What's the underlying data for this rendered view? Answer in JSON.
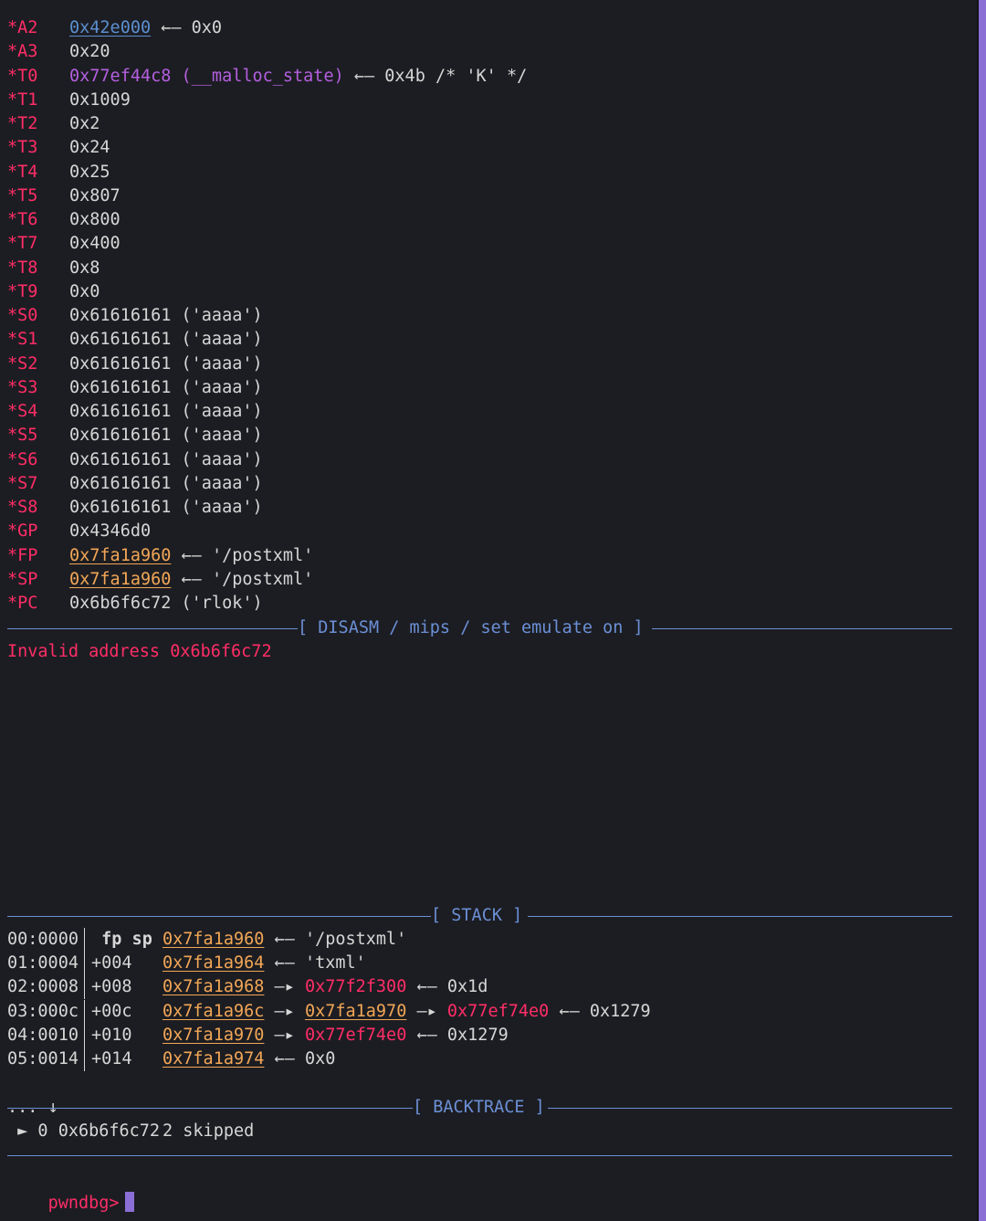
{
  "registers": [
    {
      "name": "*A2",
      "value": "0x42e000",
      "value_style": "blue",
      "suffix": " ←— 0x0"
    },
    {
      "name": "*A3",
      "value": "0x20",
      "value_style": "white",
      "suffix": ""
    },
    {
      "name": "*T0",
      "value": "0x77ef44c8 (__malloc_state)",
      "value_style": "purple",
      "suffix": " ←— 0x4b /* 'K' */"
    },
    {
      "name": "*T1",
      "value": "0x1009",
      "value_style": "white",
      "suffix": ""
    },
    {
      "name": "*T2",
      "value": "0x2",
      "value_style": "white",
      "suffix": ""
    },
    {
      "name": "*T3",
      "value": "0x24",
      "value_style": "white",
      "suffix": ""
    },
    {
      "name": "*T4",
      "value": "0x25",
      "value_style": "white",
      "suffix": ""
    },
    {
      "name": "*T5",
      "value": "0x807",
      "value_style": "white",
      "suffix": ""
    },
    {
      "name": "*T6",
      "value": "0x800",
      "value_style": "white",
      "suffix": ""
    },
    {
      "name": "*T7",
      "value": "0x400",
      "value_style": "white",
      "suffix": ""
    },
    {
      "name": "*T8",
      "value": "0x8",
      "value_style": "white",
      "suffix": ""
    },
    {
      "name": "*T9",
      "value": "0x0",
      "value_style": "white",
      "suffix": ""
    },
    {
      "name": "*S0",
      "value": "0x61616161 ('aaaa')",
      "value_style": "white",
      "suffix": ""
    },
    {
      "name": "*S1",
      "value": "0x61616161 ('aaaa')",
      "value_style": "white",
      "suffix": ""
    },
    {
      "name": "*S2",
      "value": "0x61616161 ('aaaa')",
      "value_style": "white",
      "suffix": ""
    },
    {
      "name": "*S3",
      "value": "0x61616161 ('aaaa')",
      "value_style": "white",
      "suffix": ""
    },
    {
      "name": "*S4",
      "value": "0x61616161 ('aaaa')",
      "value_style": "white",
      "suffix": ""
    },
    {
      "name": "*S5",
      "value": "0x61616161 ('aaaa')",
      "value_style": "white",
      "suffix": ""
    },
    {
      "name": "*S6",
      "value": "0x61616161 ('aaaa')",
      "value_style": "white",
      "suffix": ""
    },
    {
      "name": "*S7",
      "value": "0x61616161 ('aaaa')",
      "value_style": "white",
      "suffix": ""
    },
    {
      "name": "*S8",
      "value": "0x61616161 ('aaaa')",
      "value_style": "white",
      "suffix": ""
    },
    {
      "name": "*GP",
      "value": "0x4346d0",
      "value_style": "white",
      "suffix": ""
    },
    {
      "name": "*FP",
      "value": "0x7fa1a960",
      "value_style": "addr",
      "suffix": " ←— '/postxml'"
    },
    {
      "name": "*SP",
      "value": "0x7fa1a960",
      "value_style": "addr",
      "suffix": " ←— '/postxml'"
    },
    {
      "name": "*PC",
      "value": "0x6b6f6c72 ('rlok')",
      "value_style": "white",
      "suffix": ""
    }
  ],
  "disasm": {
    "title": "[ DISASM / mips / set emulate on ]",
    "message": "Invalid address 0x6b6f6c72"
  },
  "stack": {
    "title": "[ STACK ]",
    "rows": [
      {
        "offset": "00:0000",
        "rel": " fp sp",
        "addr": "0x7fa1a960",
        "parts": [
          {
            "t": " ←— '/postxml'",
            "c": "white"
          }
        ]
      },
      {
        "offset": "01:0004",
        "rel": "+004",
        "addr": "0x7fa1a964",
        "parts": [
          {
            "t": " ←— 'txml'",
            "c": "white"
          }
        ]
      },
      {
        "offset": "02:0008",
        "rel": "+008",
        "addr": "0x7fa1a968",
        "parts": [
          {
            "t": " —▸ ",
            "c": "white"
          },
          {
            "t": "0x77f2f300",
            "c": "heap"
          },
          {
            "t": " ←— 0x1d",
            "c": "white"
          }
        ]
      },
      {
        "offset": "03:000c",
        "rel": "+00c",
        "addr": "0x7fa1a96c",
        "parts": [
          {
            "t": " —▸ ",
            "c": "white"
          },
          {
            "t": "0x7fa1a970",
            "c": "addr"
          },
          {
            "t": " —▸ ",
            "c": "white"
          },
          {
            "t": "0x77ef74e0",
            "c": "heap"
          },
          {
            "t": " ←— 0x1279",
            "c": "white"
          }
        ]
      },
      {
        "offset": "04:0010",
        "rel": "+010",
        "addr": "0x7fa1a970",
        "parts": [
          {
            "t": " —▸ ",
            "c": "white"
          },
          {
            "t": "0x77ef74e0",
            "c": "heap"
          },
          {
            "t": " ←— 0x1279",
            "c": "white"
          }
        ]
      },
      {
        "offset": "05:0014",
        "rel": "+014",
        "addr": "0x7fa1a974",
        "parts": [
          {
            "t": " ←— 0x0",
            "c": "white"
          }
        ]
      }
    ],
    "skipped_prefix": "... ↓",
    "skipped_text": "2 skipped"
  },
  "backtrace": {
    "title": "[ BACKTRACE ]",
    "entry": " ► 0 0x6b6f6c72"
  },
  "prompt": {
    "label": "pwndbg>"
  }
}
